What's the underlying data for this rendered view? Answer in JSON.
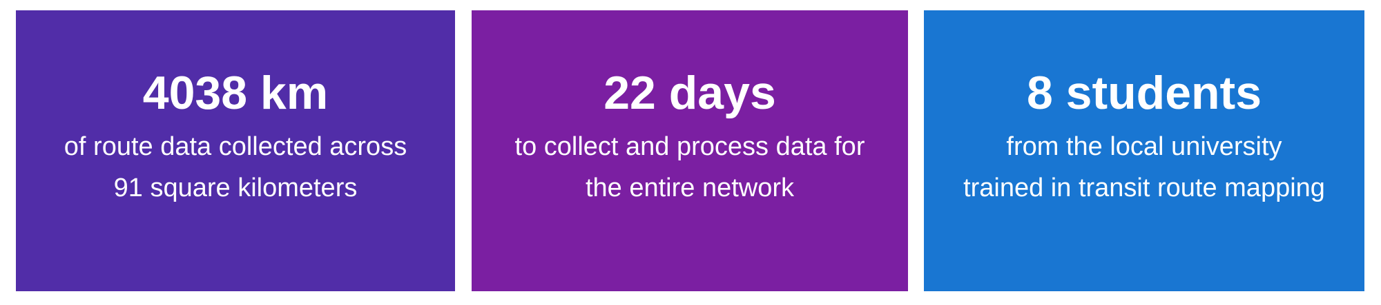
{
  "stats": [
    {
      "value": "4038 km",
      "line1": "of route data collected across",
      "line2": "91 square kilometers",
      "color": "#512DA8"
    },
    {
      "value": "22 days",
      "line1": "to collect and process data for",
      "line2": "the entire network",
      "color": "#7B1FA2"
    },
    {
      "value": "8 students",
      "line1": "from the local university",
      "line2": "trained in transit route mapping",
      "color": "#1976D2"
    }
  ]
}
